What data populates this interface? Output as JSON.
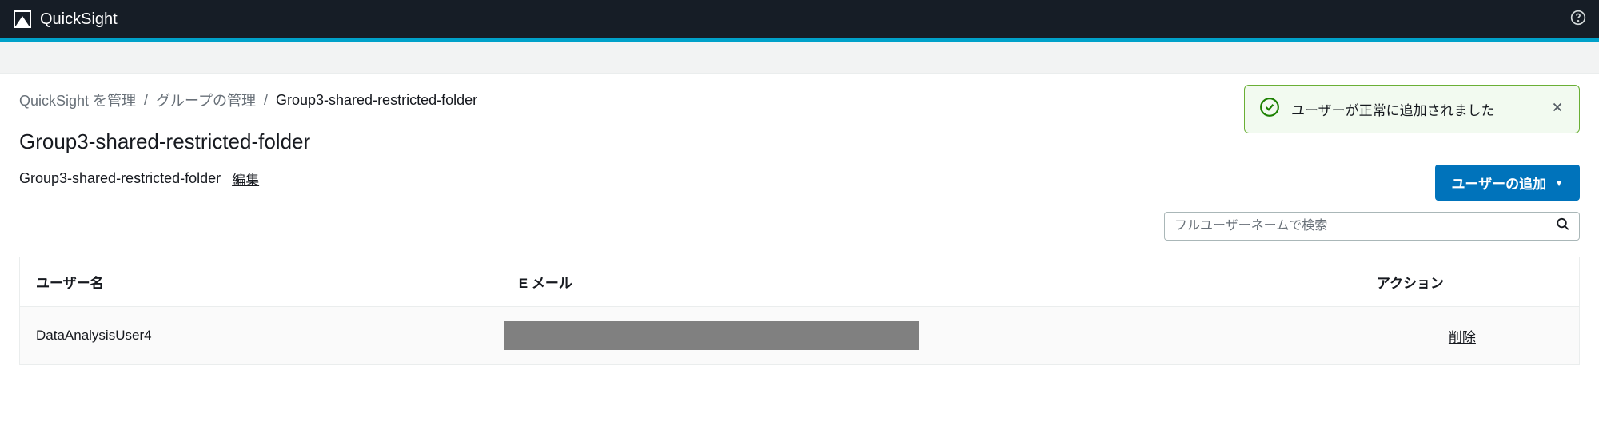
{
  "header": {
    "brand": "QuickSight"
  },
  "breadcrumb": {
    "items": [
      {
        "label": "QuickSight を管理"
      },
      {
        "label": "グループの管理"
      }
    ],
    "current": "Group3-shared-restricted-folder"
  },
  "notification": {
    "message": "ユーザーが正常に追加されました"
  },
  "page": {
    "title": "Group3-shared-restricted-folder",
    "subtitle": "Group3-shared-restricted-folder",
    "edit_label": "編集"
  },
  "actions": {
    "add_user_label": "ユーザーの追加"
  },
  "search": {
    "placeholder": "フルユーザーネームで検索"
  },
  "table": {
    "headers": {
      "username": "ユーザー名",
      "email": "E メール",
      "action": "アクション"
    },
    "rows": [
      {
        "username": "DataAnalysisUser4",
        "email_redacted": true,
        "action_label": "削除"
      }
    ]
  }
}
